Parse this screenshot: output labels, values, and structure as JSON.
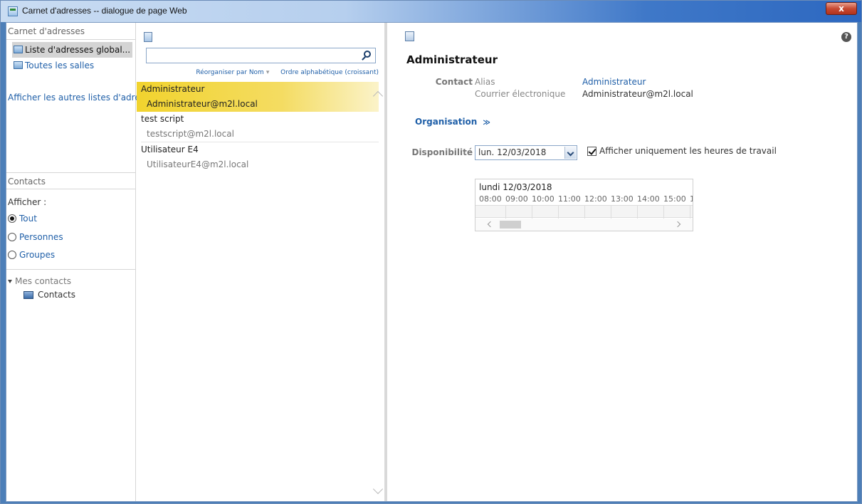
{
  "window": {
    "title": "Carnet d'adresses -- dialogue de page Web",
    "close_label": "x"
  },
  "left": {
    "header": "Carnet d'adresses",
    "items": [
      {
        "label": "Liste d'adresses global...",
        "icon": "address-book-icon"
      },
      {
        "label": "Toutes les salles",
        "icon": "address-book-icon"
      }
    ],
    "other_lists": "Afficher les autres listes d'adresses",
    "contacts_header": "Contacts",
    "show_label": "Afficher :",
    "radios": [
      {
        "label": "Tout",
        "checked": true
      },
      {
        "label": "Personnes",
        "checked": false
      },
      {
        "label": "Groupes",
        "checked": false
      }
    ],
    "my_contacts": "Mes contacts",
    "contacts_folder": "Contacts"
  },
  "middle": {
    "search_placeholder": "",
    "sort_by": "Réorganiser par Nom",
    "sort_order": "Ordre alphabétique (croissant)",
    "entries": [
      {
        "name": "Administrateur",
        "email": "Administrateur@m2l.local",
        "selected": true
      },
      {
        "name": "test script",
        "email": "testscript@m2l.local",
        "selected": false
      },
      {
        "name": "Utilisateur E4",
        "email": "UtilisateurE4@m2l.local",
        "selected": false
      }
    ]
  },
  "details": {
    "name": "Administrateur",
    "contact_label": "Contact",
    "alias_label": "Alias",
    "alias_value": "Administrateur",
    "email_label": "Courrier électronique",
    "email_value": "Administrateur@m2l.local",
    "organisation_label": "Organisation",
    "availability_label": "Disponibilité",
    "date_value": "lun. 12/03/2018",
    "work_hours_label": "Afficher uniquement les heures de travail",
    "work_hours_checked": true,
    "schedule_day": "lundi 12/03/2018",
    "schedule_hours": [
      "08:00",
      "09:00",
      "10:00",
      "11:00",
      "12:00",
      "13:00",
      "14:00",
      "15:00",
      "1"
    ]
  }
}
